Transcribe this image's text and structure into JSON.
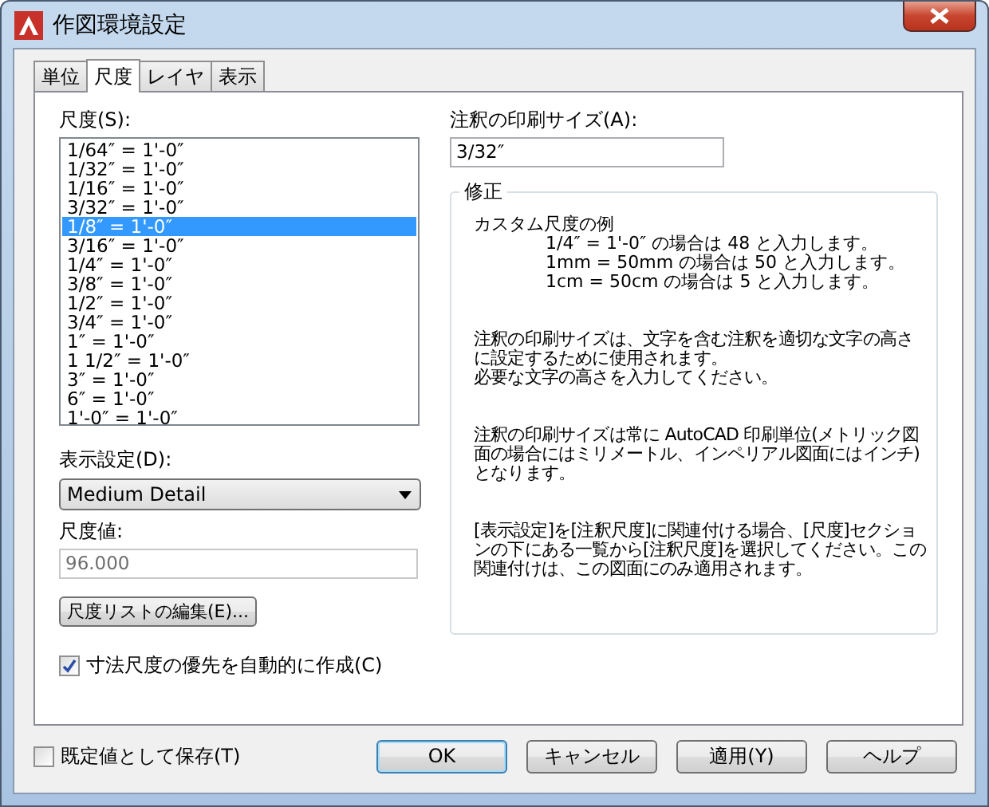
{
  "window": {
    "title": "作図環境設定"
  },
  "tabs": [
    {
      "label": "単位",
      "selected": false
    },
    {
      "label": "尺度",
      "selected": true
    },
    {
      "label": "レイヤ",
      "selected": false
    },
    {
      "label": "表示",
      "selected": false
    }
  ],
  "scale": {
    "label": "尺度(S):",
    "items": [
      {
        "text": "1/64″ = 1'-0″",
        "selected": false
      },
      {
        "text": "1/32″ = 1'-0″",
        "selected": false
      },
      {
        "text": "1/16″ = 1'-0″",
        "selected": false
      },
      {
        "text": "3/32″ = 1'-0″",
        "selected": false
      },
      {
        "text": "1/8″ = 1'-0″",
        "selected": true
      },
      {
        "text": "3/16″ = 1'-0″",
        "selected": false
      },
      {
        "text": "1/4″ = 1'-0″",
        "selected": false
      },
      {
        "text": "3/8″ = 1'-0″",
        "selected": false
      },
      {
        "text": "1/2″ = 1'-0″",
        "selected": false
      },
      {
        "text": "3/4″ = 1'-0″",
        "selected": false
      },
      {
        "text": "1″ = 1'-0″",
        "selected": false
      },
      {
        "text": "1 1/2″ = 1'-0″",
        "selected": false
      },
      {
        "text": "3″ = 1'-0″",
        "selected": false
      },
      {
        "text": "6″ = 1'-0″",
        "selected": false
      },
      {
        "text": "1'-0″ = 1'-0″",
        "selected": false
      }
    ]
  },
  "display_setting": {
    "label": "表示設定(D):",
    "value": "Medium Detail"
  },
  "scale_value": {
    "label": "尺度値:",
    "value": "96.000",
    "disabled": true
  },
  "edit_list_button": "尺度リストの編集(E)...",
  "auto_dim_scale": {
    "label": "寸法尺度の優先を自動的に作成(C)",
    "checked": true
  },
  "print_size": {
    "label": "注釈の印刷サイズ(A):",
    "value": "3/32″"
  },
  "group": {
    "title": "修正",
    "heading": "カスタム尺度の例",
    "examples": [
      "1/4″ = 1'-0″ の場合は 48 と入力します。",
      "1mm = 50mm の場合は 50 と入力します。",
      "1cm = 50cm の場合は 5 と入力します。"
    ],
    "paragraphs": [
      [
        "注釈の印刷サイズは、文字を含む注釈を適切な文字の高さに設定するために使用されます。",
        "必要な文字の高さを入力してください。"
      ],
      [
        "注釈の印刷サイズは常に AutoCAD 印刷単位(メトリック図面の場合にはミリメートル、インペリアル図面にはインチ)となります。"
      ],
      [
        "[表示設定]を[注釈尺度]に関連付ける場合、[尺度]セクションの下にある一覧から[注釈尺度]を選択してください。この関連付けは、この図面にのみ適用されます。"
      ]
    ]
  },
  "save_default": {
    "label": "既定値として保存(T)",
    "checked": false
  },
  "buttons": [
    "OK",
    "キャンセル",
    "適用(Y)",
    "ヘルプ"
  ]
}
